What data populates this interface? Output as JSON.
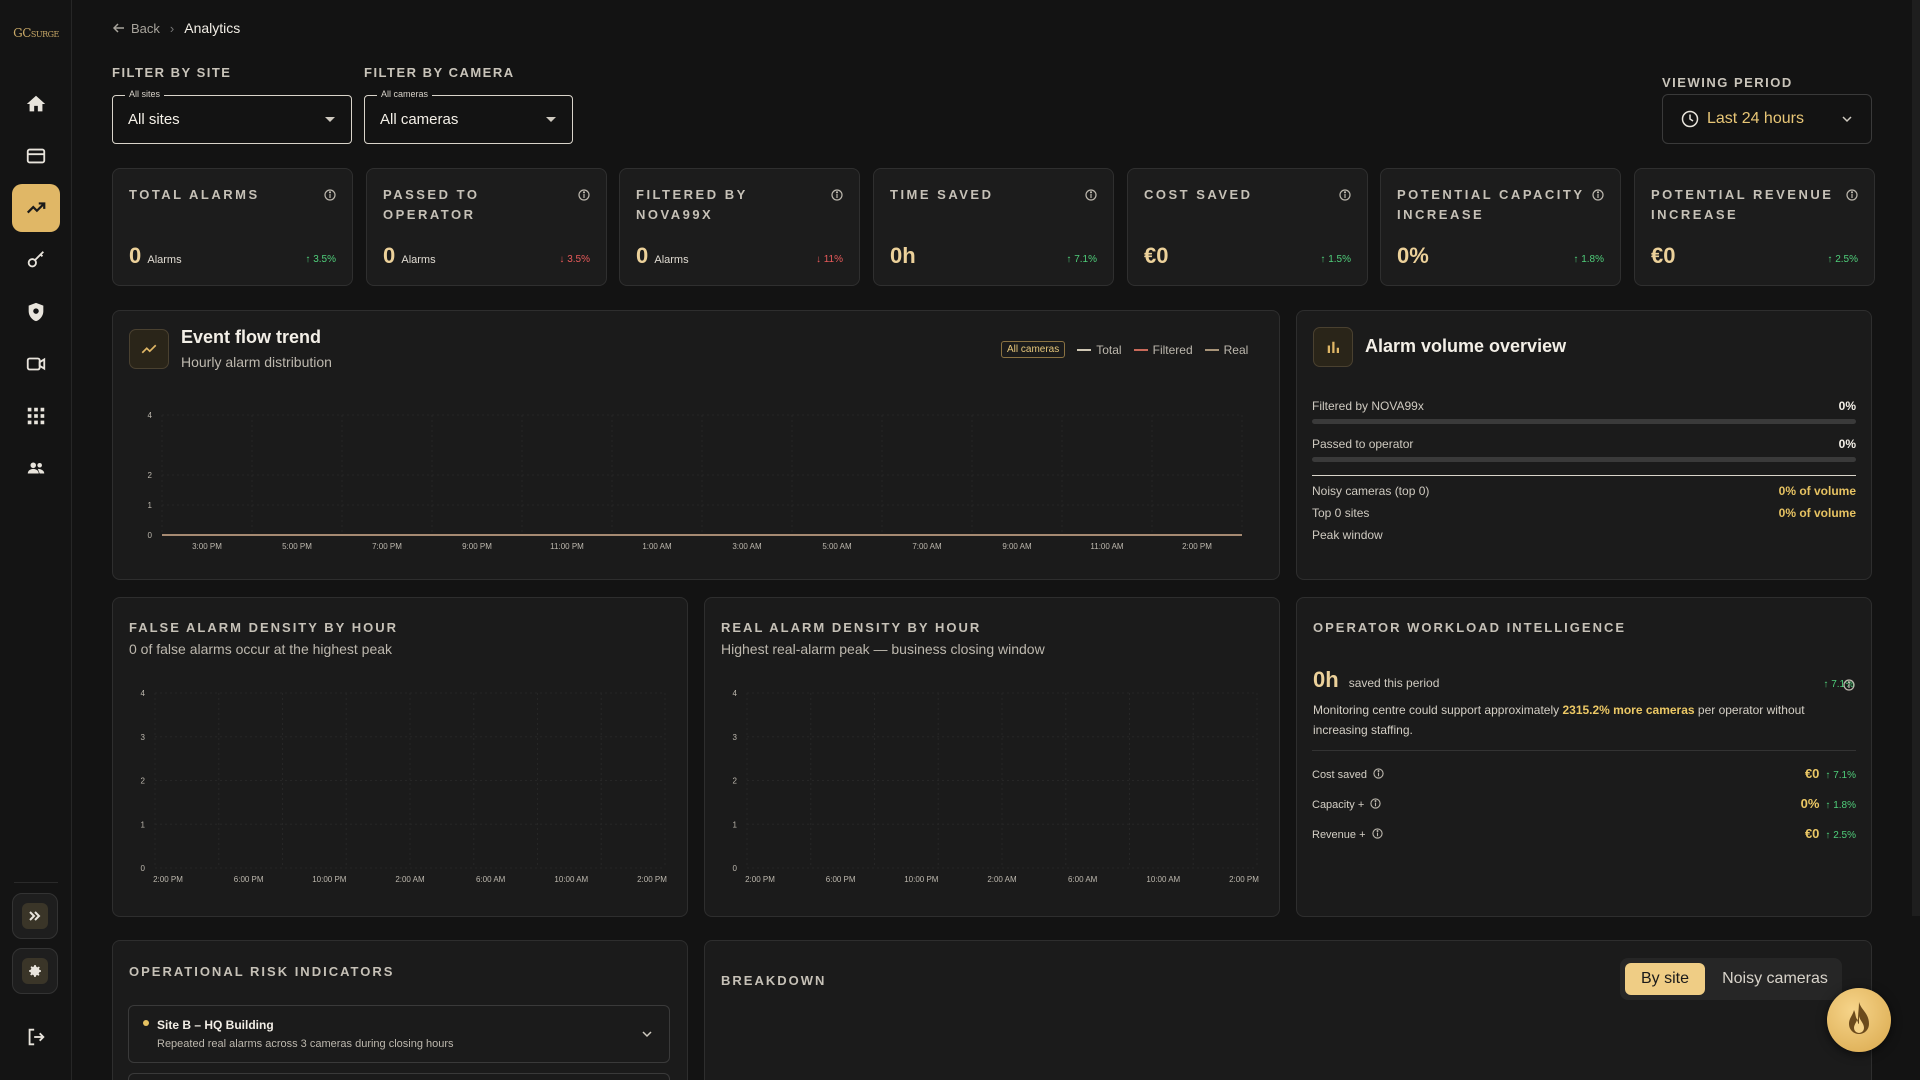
{
  "brand": {
    "logo_text": "GC",
    "logo_small": "SURGE"
  },
  "breadcrumb": {
    "back": "Back",
    "current": "Analytics"
  },
  "filters": {
    "site_label": "FILTER BY SITE",
    "site_float": "All sites",
    "site_value": "All sites",
    "camera_label": "FILTER BY CAMERA",
    "camera_float": "All cameras",
    "camera_value": "All cameras",
    "period_label": "VIEWING PERIOD",
    "period_value": "Last 24 hours"
  },
  "kpis": [
    {
      "title": "TOTAL ALARMS",
      "value": "0",
      "unit": "Alarms",
      "delta": "↑ 3.5%",
      "trend": "up"
    },
    {
      "title": "PASSED TO OPERATOR",
      "value": "0",
      "unit": "Alarms",
      "delta": "↓ 3.5%",
      "trend": "down"
    },
    {
      "title": "FILTERED BY NOVA99X",
      "value": "0",
      "unit": "Alarms",
      "delta": "↓ 11%",
      "trend": "down"
    },
    {
      "title": "TIME SAVED",
      "value": "0h",
      "unit": "",
      "delta": "↑ 7.1%",
      "trend": "up"
    },
    {
      "title": "COST SAVED",
      "value": "€0",
      "unit": "",
      "delta": "↑ 1.5%",
      "trend": "up"
    },
    {
      "title": "POTENTIAL CAPACITY INCREASE",
      "value": "0%",
      "unit": "",
      "delta": "↑ 1.8%",
      "trend": "up"
    },
    {
      "title": "POTENTIAL REVENUE INCREASE",
      "value": "€0",
      "unit": "",
      "delta": "↑ 2.5%",
      "trend": "up"
    }
  ],
  "event_flow": {
    "title": "Event flow trend",
    "subtitle": "Hourly alarm distribution",
    "chip": "All cameras",
    "legend": [
      "Total",
      "Filtered",
      "Real"
    ]
  },
  "alarm_volume": {
    "title": "Alarm volume overview",
    "filtered_label": "Filtered by NOVA99x",
    "filtered_pct": "0%",
    "filtered_fraction": 0,
    "passed_label": "Passed to operator",
    "passed_pct": "0%",
    "passed_fraction": 0,
    "noisy_label": "Noisy cameras (top 0)",
    "noisy_value": "0% of volume",
    "sites_label": "Top 0 sites",
    "sites_value": "0% of volume",
    "peak_label": "Peak window"
  },
  "false_density": {
    "title": "FALSE ALARM DENSITY BY HOUR",
    "subtitle": "0 of false alarms occur at the highest peak"
  },
  "real_density": {
    "title": "REAL ALARM DENSITY BY HOUR",
    "subtitle": "Highest real-alarm peak — business closing window"
  },
  "workload": {
    "title": "OPERATOR WORKLOAD INTELLIGENCE",
    "hours": "0h",
    "hours_caption": "saved this period",
    "delta": "↑ 7.1%",
    "text_before": "Monitoring centre could support approximately ",
    "text_highlight": "2315.2% more cameras",
    "text_after": " per operator without increasing staffing.",
    "rows": [
      {
        "label": "Cost saved",
        "value": "€0",
        "delta": "↑ 7.1%"
      },
      {
        "label": "Capacity +",
        "value": "0%",
        "delta": "↑ 1.8%"
      },
      {
        "label": "Revenue +",
        "value": "€0",
        "delta": "↑ 2.5%"
      }
    ]
  },
  "risk": {
    "title": "OPERATIONAL RISK INDICATORS",
    "item_title": "Site B – HQ Building",
    "item_desc": "Repeated real alarms across 3 cameras during closing hours"
  },
  "breakdown": {
    "title": "BREAKDOWN",
    "tab_site": "By site",
    "tab_noisy": "Noisy cameras"
  },
  "colors": {
    "accent": "#e0b766",
    "up": "#4fce7a",
    "down": "#e85a5a"
  },
  "chart_data": [
    {
      "type": "line",
      "title": "Event flow trend",
      "x": [
        "3:00 PM",
        "5:00 PM",
        "7:00 PM",
        "9:00 PM",
        "11:00 PM",
        "1:00 AM",
        "3:00 AM",
        "5:00 AM",
        "7:00 AM",
        "9:00 AM",
        "11:00 AM",
        "2:00 PM"
      ],
      "yticks": [
        0,
        1,
        2,
        4
      ],
      "ylim": [
        0,
        4
      ],
      "series": [
        {
          "name": "Total",
          "values": [
            0,
            0,
            0,
            0,
            0,
            0,
            0,
            0,
            0,
            0,
            0,
            0
          ]
        },
        {
          "name": "Filtered",
          "values": [
            0,
            0,
            0,
            0,
            0,
            0,
            0,
            0,
            0,
            0,
            0,
            0
          ]
        },
        {
          "name": "Real",
          "values": [
            0,
            0,
            0,
            0,
            0,
            0,
            0,
            0,
            0,
            0,
            0,
            0
          ]
        }
      ]
    },
    {
      "type": "bar",
      "title": "FALSE ALARM DENSITY BY HOUR",
      "x": [
        "2:00 PM",
        "6:00 PM",
        "10:00 PM",
        "2:00 AM",
        "6:00 AM",
        "10:00 AM",
        "2:00 PM"
      ],
      "yticks": [
        0,
        1,
        2,
        3,
        4
      ],
      "ylim": [
        0,
        4
      ],
      "values": [
        0,
        0,
        0,
        0,
        0,
        0,
        0
      ]
    },
    {
      "type": "bar",
      "title": "REAL ALARM DENSITY BY HOUR",
      "x": [
        "2:00 PM",
        "6:00 PM",
        "10:00 PM",
        "2:00 AM",
        "6:00 AM",
        "10:00 AM",
        "2:00 PM"
      ],
      "yticks": [
        0,
        1,
        2,
        3,
        4
      ],
      "ylim": [
        0,
        4
      ],
      "values": [
        0,
        0,
        0,
        0,
        0,
        0,
        0
      ]
    }
  ]
}
